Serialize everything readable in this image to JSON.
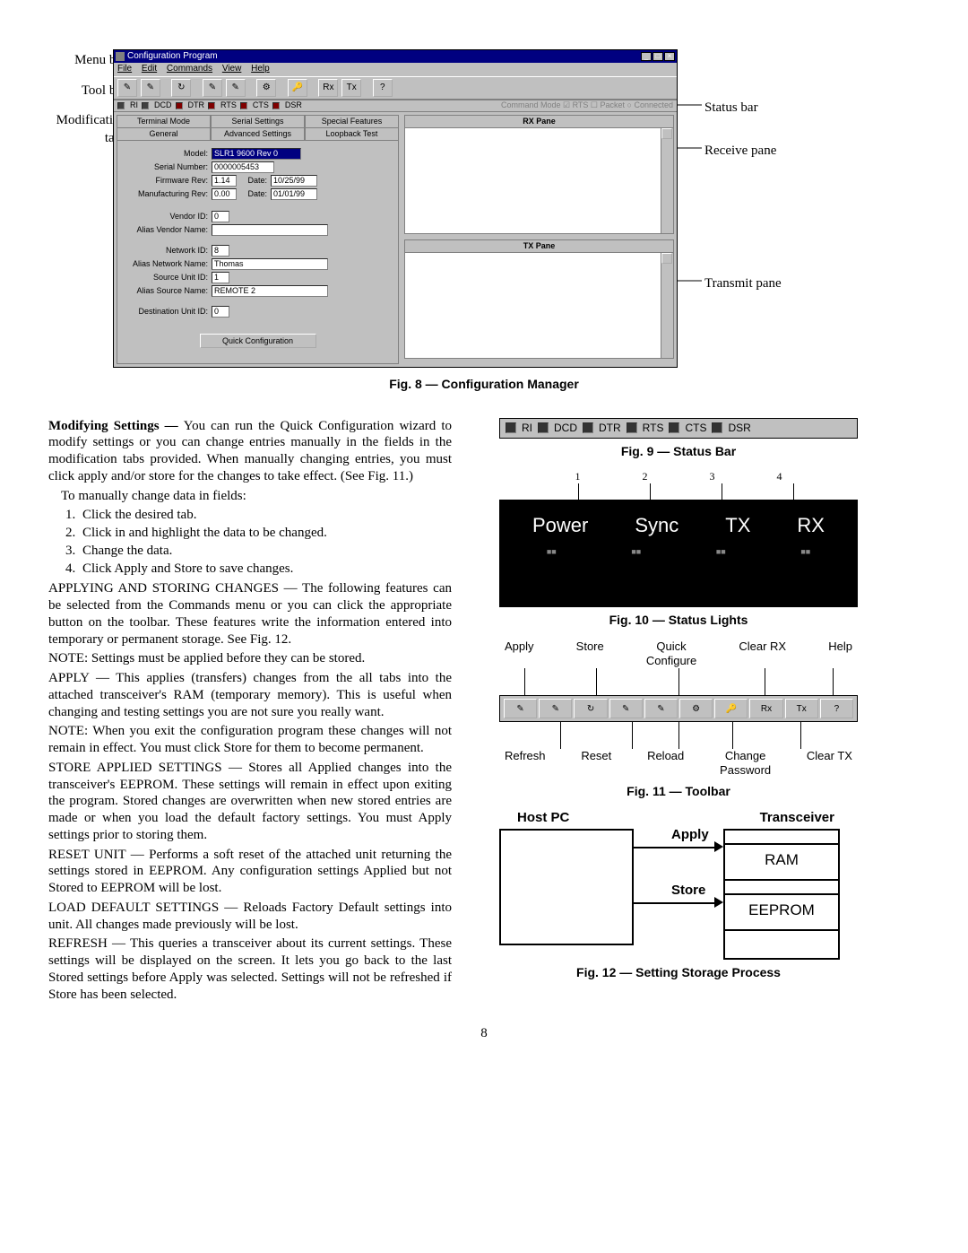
{
  "page_number": "8",
  "fig8": {
    "left_labels": [
      "Menu bar",
      "Tool bar",
      "Modification",
      "tabs"
    ],
    "right_labels": [
      "Status bar",
      "Receive pane",
      "Transmit pane"
    ],
    "title": "Configuration Program",
    "caption": "Fig. 8 — Configuration Manager",
    "menus": [
      "File",
      "Edit",
      "Commands",
      "View",
      "Help"
    ],
    "status_items": [
      "RI",
      "DCD",
      "DTR",
      "RTS",
      "CTS",
      "DSR"
    ],
    "status_right": "Command Mode  ☑ RTS ☐ Packet  ○ Connected",
    "tabs_top": [
      "Terminal Mode",
      "Serial Settings",
      "Special Features"
    ],
    "tabs_bottom": [
      "General",
      "Advanced Settings",
      "Loopback Test"
    ],
    "fields": {
      "model_lbl": "Model:",
      "model": "SLR1 9600 Rev 0",
      "serial_lbl": "Serial Number:",
      "serial": "0000005453",
      "fw_lbl": "Firmware Rev:",
      "fw": "1.14",
      "fw_date_lbl": "Date:",
      "fw_date": "10/25/99",
      "mfg_lbl": "Manufacturing Rev:",
      "mfg": "0.00",
      "mfg_date_lbl": "Date:",
      "mfg_date": "01/01/99",
      "vendor_lbl": "Vendor ID:",
      "vendor": "0",
      "avn_lbl": "Alias Vendor Name:",
      "avn": "",
      "net_lbl": "Network ID:",
      "net": "8",
      "ann_lbl": "Alias Network Name:",
      "ann": "Thomas",
      "su_lbl": "Source Unit ID:",
      "su": "1",
      "asn_lbl": "Alias Source Name:",
      "asn": "REMOTE 2",
      "du_lbl": "Destination Unit ID:",
      "du": "0"
    },
    "quick_btn": "Quick Configuration",
    "rx_title": "RX Pane",
    "tx_title": "TX Pane"
  },
  "body": {
    "heading": "Modifying Settings — ",
    "p1": "You can run the Quick Configu­ration wizard to modify settings or you can change entries manually in the fields in the modification tabs provided. When manually changing entries, you must click apply and/or store for the changes to take effect. (See Fig. 11.)",
    "p2": "To manually change data in fields:",
    "steps": [
      "Click the desired tab.",
      "Click in and highlight the data to be changed.",
      "Change the data.",
      "Click Apply and Store to save changes."
    ],
    "p3": "APPLYING AND STORING CHANGES — The following features can be selected from the Commands menu or you can click the appropriate button on the toolbar. These features write the information entered into temporary or permanent storage. See Fig. 12.",
    "p4": "NOTE: Settings must be applied before they can be stored.",
    "p5": "APPLY —  This applies (transfers) changes from the all tabs into the attached transceiver's RAM (temporary memory). This is useful when changing and testing settings you are not sure you really want.",
    "p6": "NOTE: When you exit the configuration program these changes will not remain in effect. You must click Store for them to become permanent.",
    "p7": "STORE APPLIED SETTINGS — Stores all Applied chang­es into the transceiver's EEPROM. These settings will remain in effect upon exiting the program. Stored changes are over­written when new stored entries are made or when you load the default factory settings. You must Apply settings prior to stor­ing them.",
    "p8": "RESET UNIT — Performs a soft reset of the attached unit re­turning the settings stored in EEPROM. Any configuration set­tings Applied but not Stored to EEPROM will be lost.",
    "p9": "LOAD DEFAULT SETTINGS — Reloads Factory Default settings into unit. All changes made previously will be lost.",
    "p10": "REFRESH — This queries a transceiver about its current set­tings. These settings will be displayed on the screen. It lets you go back to the last Stored settings before Apply was selected. Settings will not be refreshed if Store has been selected."
  },
  "fig9": {
    "caption": "Fig. 9 — Status Bar",
    "items": [
      "RI",
      "DCD",
      "DTR",
      "RTS",
      "CTS",
      "DSR"
    ]
  },
  "fig10": {
    "caption": "Fig. 10 — Status Lights",
    "nums": [
      "1",
      "2",
      "3",
      "4"
    ],
    "labels": [
      "Power",
      "Sync",
      "TX",
      "RX"
    ]
  },
  "fig11": {
    "caption": "Fig. 11 — Toolbar",
    "top": [
      "Apply",
      "Store",
      "Quick\nConfigure",
      "Clear RX",
      "Help"
    ],
    "bottom": [
      "Refresh",
      "Reset",
      "Reload",
      "Change\nPassword",
      "Clear TX"
    ]
  },
  "fig12": {
    "caption": "Fig. 12 — Setting Storage Process",
    "host": "Host PC",
    "trans": "Transceiver",
    "apply": "Apply",
    "store": "Store",
    "ram": "RAM",
    "eeprom": "EEPROM"
  }
}
